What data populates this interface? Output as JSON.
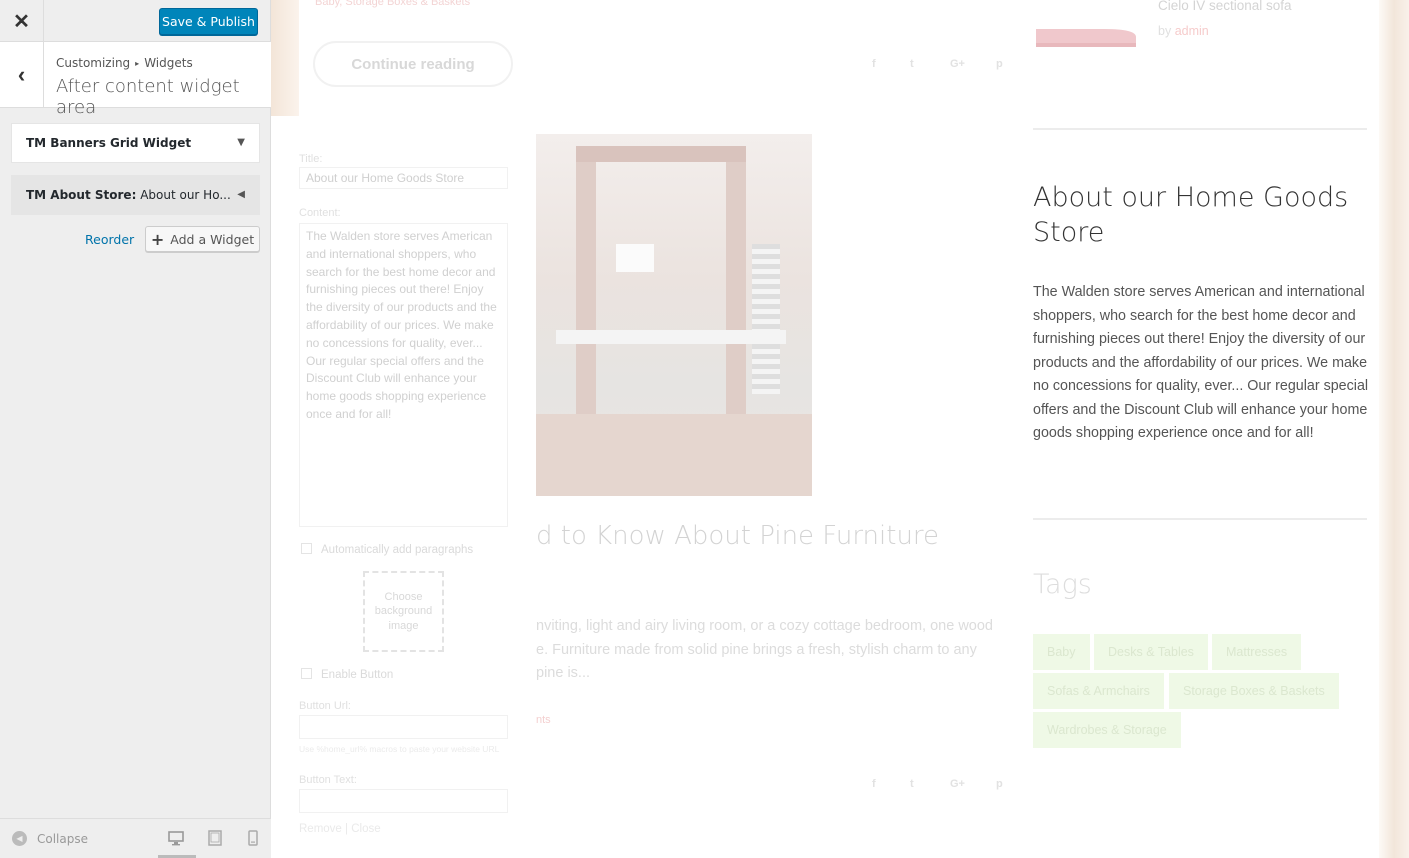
{
  "sidebar": {
    "close_glyph": "✕",
    "save_label": "Save & Publish",
    "back_glyph": "‹",
    "breadcrumb": {
      "root": "Customizing",
      "separator": "▸",
      "current": "Widgets"
    },
    "section_title": "After content widget area",
    "widgets": [
      {
        "name": "TM Banners Grid Widget",
        "subtitle": "",
        "arrow": "▼"
      },
      {
        "name": "TM About Store:",
        "subtitle": " About our Ho...",
        "arrow": "◀"
      }
    ],
    "reorder_label": "Reorder",
    "add_widget_label": "Add a Widget",
    "add_widget_glyph": "+",
    "collapse_label": "Collapse",
    "collapse_glyph": "◀",
    "devices": [
      "desktop-icon",
      "tablet-icon",
      "mobile-icon"
    ]
  },
  "widget_form": {
    "title_label": "Title:",
    "title_value": "About our Home Goods Store",
    "content_label": "Content:",
    "content_value": "The Walden store serves American and international shoppers, who search for the best home decor and furnishing pieces out there! Enjoy the diversity of our products and the affordability of our prices. We make no concessions for quality, ever...  Our regular special offers and the Discount Club will enhance your home goods shopping experience once and for all!",
    "auto_paragraphs_label": "Automatically add paragraphs",
    "choose_bg_label": "Choose background image",
    "enable_button_label": "Enable Button",
    "button_url_label": "Button Url:",
    "button_url_hint": "Use %home_url% macros to paste your website URL",
    "button_text_label": "Button Text:",
    "remove_label": "Remove",
    "actions_separator": " | ",
    "close_label": "Close"
  },
  "preview": {
    "top_tags": "Baby, Storage Boxes & Baskets",
    "continue_reading": "Continue reading",
    "social": [
      "f",
      "t",
      "G+",
      "p"
    ],
    "post_title": "d to Know About Pine Furniture",
    "post_excerpt": "nviting, light and airy living room, or a cozy cottage bedroom, one wood e. Furniture made from solid pine brings a fresh, stylish charm to any pine is...",
    "post_more": "nts",
    "product": {
      "title": "Cielo IV sectional sofa",
      "by": "by",
      "author": "admin"
    },
    "about": {
      "title": "About our Home Goods Store",
      "text": "The Walden store serves American and international shoppers, who search for the best home decor and furnishing pieces out there! Enjoy the diversity of our products and the affordability of our prices. We make no concessions for quality, ever... Our regular special offers and the Discount Club will enhance your home goods shopping experience once and for all!"
    },
    "tags_title": "Tags",
    "tags": [
      "Baby",
      "Desks & Tables",
      "Mattresses",
      "Sofas & Armchairs",
      "Storage Boxes & Baskets",
      "Wardrobes & Storage"
    ]
  },
  "colors": {
    "primary_button": "#0085ba",
    "link": "#0073aa",
    "sidebar_bg": "#eeeeee",
    "tag_bg": "#eff9e6"
  }
}
